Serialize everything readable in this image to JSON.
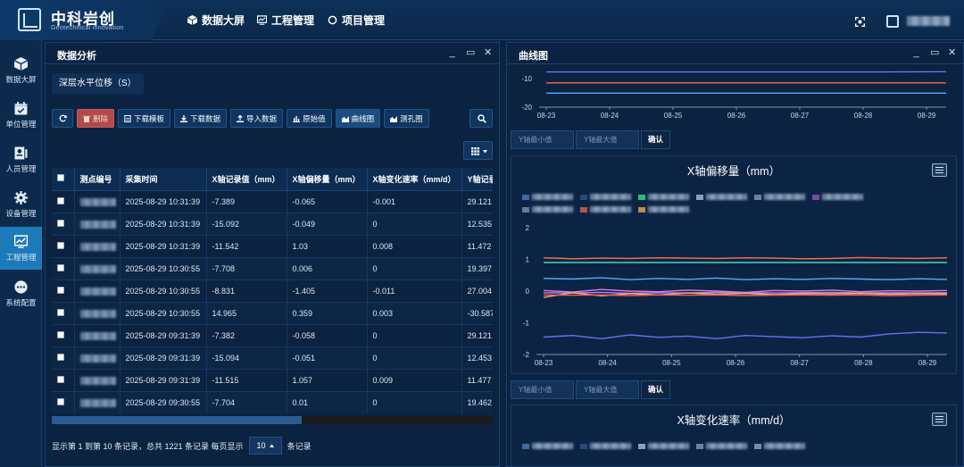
{
  "app": {
    "title": "中科岩创",
    "subtitle": "Geotechnical innovation",
    "nav": [
      {
        "label": "数据大屏",
        "icon": "cube-icon"
      },
      {
        "label": "工程管理",
        "icon": "chart-screen-icon"
      },
      {
        "label": "项目管理",
        "icon": "circle-icon"
      }
    ]
  },
  "sidebar": {
    "items": [
      {
        "label": "数据大屏",
        "icon": "cube-icon",
        "active": false
      },
      {
        "label": "单位管理",
        "icon": "calendar-icon",
        "active": false
      },
      {
        "label": "人员管理",
        "icon": "user-card-icon",
        "active": false
      },
      {
        "label": "设备管理",
        "icon": "gear-icon",
        "active": false
      },
      {
        "label": "工程管理",
        "icon": "chart-monitor-icon",
        "active": true
      },
      {
        "label": "系统配置",
        "icon": "dots-icon",
        "active": false
      }
    ]
  },
  "left_panel": {
    "title": "数据分析",
    "tag": "深层水平位移（S）",
    "toolbar": {
      "refresh": "",
      "delete": "删除",
      "download_template": "下载模板",
      "download_data": "下载数据",
      "import_data": "导入数据",
      "raw_value": "原始值",
      "curve_chart": "曲线图",
      "borehole_chart": "测孔图"
    },
    "table": {
      "columns": [
        "测点编号",
        "采集时间",
        "X轴记录值（mm）",
        "X轴偏移量（mm）",
        "X轴变化速率（mm/d）",
        "Y轴记录"
      ],
      "rows": [
        [
          "2025-08-29 10:31:39",
          "-7.389",
          "-0.065",
          "-0.001",
          "29.121"
        ],
        [
          "2025-08-29 10:31:39",
          "-15.092",
          "-0.049",
          "0",
          "12.535"
        ],
        [
          "2025-08-29 10:31:39",
          "-11.542",
          "1.03",
          "0.008",
          "11.472"
        ],
        [
          "2025-08-29 10:30:55",
          "-7.708",
          "0.006",
          "0",
          "19.397"
        ],
        [
          "2025-08-29 10:30:55",
          "-8.831",
          "-1.405",
          "-0.011",
          "27.004"
        ],
        [
          "2025-08-29 10:30:55",
          "14.965",
          "0.359",
          "0.003",
          "-30.587"
        ],
        [
          "2025-08-29 09:31:39",
          "-7.382",
          "-0.058",
          "0",
          "29.121"
        ],
        [
          "2025-08-29 09:31:39",
          "-15.094",
          "-0.051",
          "0",
          "12.453"
        ],
        [
          "2025-08-29 09:31:39",
          "-11.515",
          "1.057",
          "0.009",
          "11.477"
        ],
        [
          "2025-08-29 09:30:55",
          "-7.704",
          "0.01",
          "0",
          "19.462"
        ]
      ]
    },
    "pager": {
      "summary": "显示第 1 到第 10 条记录，总共 1221 条记录 每页显示",
      "page_size": "10",
      "suffix": "条记录"
    }
  },
  "right_panel": {
    "title": "曲线图",
    "y_min_placeholder": "Y轴最小值",
    "y_max_placeholder": "Y轴最大值",
    "confirm": "确认"
  },
  "chart_data": [
    {
      "type": "line",
      "title": "",
      "categories": [
        "08-23",
        "08-24",
        "08-25",
        "08-26",
        "08-27",
        "08-28",
        "08-29"
      ],
      "yticks": [
        "-10",
        "-20"
      ],
      "ylim": [
        -20,
        -5
      ],
      "series_colors": [
        "#7a6cf0",
        "#ff6a3d",
        "#5aa8ff"
      ],
      "series": [
        {
          "values": [
            -7.7,
            -7.7,
            -7.7,
            -7.7,
            -7.7,
            -7.7,
            -7.6
          ]
        },
        {
          "values": [
            -11.5,
            -11.5,
            -11.5,
            -11.5,
            -11.5,
            -11.5,
            -11.5
          ]
        },
        {
          "values": [
            -15.1,
            -15.1,
            -15.1,
            -15.1,
            -15.1,
            -15.1,
            -15.1
          ]
        }
      ]
    },
    {
      "type": "line",
      "title": "X轴偏移量（mm）",
      "categories": [
        "08-23",
        "08-24",
        "08-25",
        "08-26",
        "08-27",
        "08-28",
        "08-29"
      ],
      "yticks": [
        "2",
        "1",
        "0",
        "-1",
        "-2"
      ],
      "ylim": [
        -2,
        2
      ],
      "series_colors": [
        "#ff7043",
        "#3dd6c0",
        "#5aa8ff",
        "#e07adf",
        "#a78bfa",
        "#f7b267",
        "#ff5a5a",
        "#6f6cf5"
      ],
      "series": [
        {
          "values": [
            1.05,
            1.02,
            1.04,
            1.03,
            1.05,
            1.04,
            1.03,
            1.05,
            1.04,
            1.02,
            1.03,
            1.06,
            1.04,
            1.03,
            1.05
          ]
        },
        {
          "values": [
            0.9,
            0.9,
            0.9,
            0.9,
            0.9,
            0.9,
            0.9,
            0.9,
            0.9,
            0.9,
            0.9,
            0.9,
            0.9,
            0.9,
            0.9
          ]
        },
        {
          "values": [
            0.4,
            0.38,
            0.42,
            0.36,
            0.4,
            0.37,
            0.41,
            0.36,
            0.39,
            0.37,
            0.4,
            0.38,
            0.36,
            0.39,
            0.37
          ]
        },
        {
          "values": [
            0.02,
            -0.03,
            0.05,
            0.0,
            -0.02,
            0.03,
            0.0,
            -0.04,
            0.02,
            0.0,
            0.03,
            -0.02,
            0.01,
            0.0,
            0.02
          ]
        },
        {
          "values": [
            -0.05,
            -0.06,
            -0.04,
            -0.07,
            -0.05,
            -0.06,
            -0.04,
            -0.05,
            -0.06,
            -0.05,
            -0.04,
            -0.06,
            -0.05,
            -0.06,
            -0.05
          ]
        },
        {
          "values": [
            -0.2,
            -0.05,
            -0.15,
            -0.08,
            -0.12,
            -0.06,
            -0.1,
            -0.07,
            -0.11,
            -0.08,
            -0.09,
            -0.07,
            -0.1,
            -0.08,
            -0.09
          ]
        },
        {
          "values": [
            -0.12,
            -0.13,
            -0.12,
            -0.14,
            -0.12,
            -0.13,
            -0.12,
            -0.14,
            -0.13,
            -0.12,
            -0.13,
            -0.12,
            -0.14,
            -0.13,
            -0.12
          ]
        },
        {
          "values": [
            -1.45,
            -1.4,
            -1.5,
            -1.38,
            -1.46,
            -1.42,
            -1.5,
            -1.4,
            -1.44,
            -1.47,
            -1.41,
            -1.45,
            -1.35,
            -1.3,
            -1.32
          ]
        }
      ]
    },
    {
      "type": "line",
      "title": "X轴变化速率（mm/d）",
      "categories": [],
      "series": []
    }
  ]
}
